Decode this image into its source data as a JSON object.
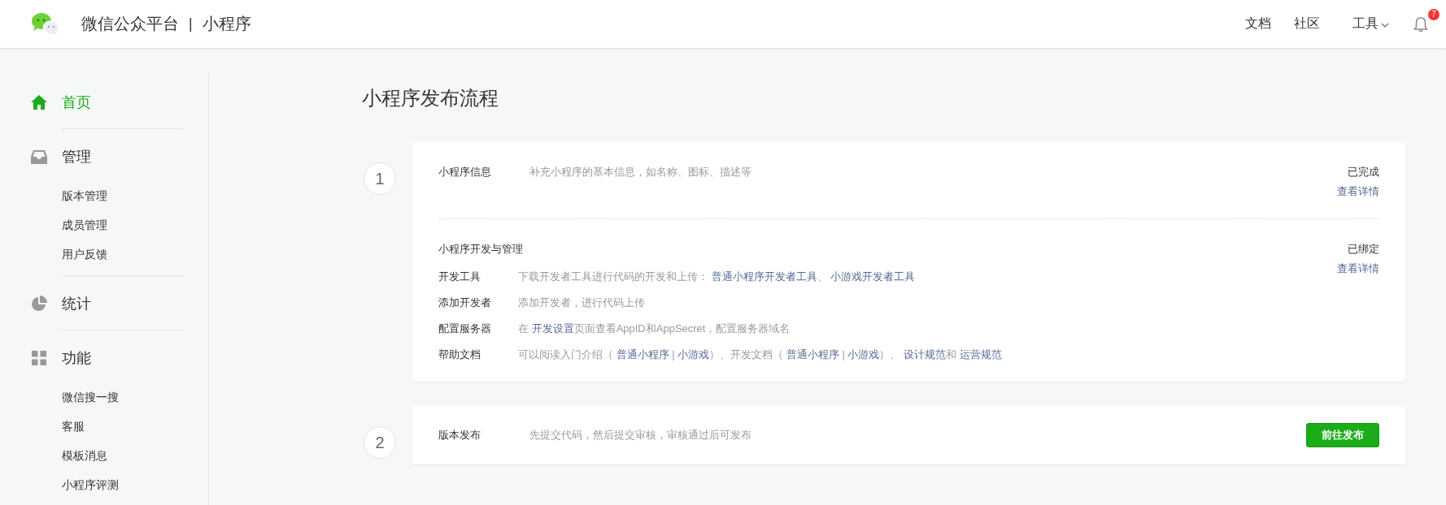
{
  "header": {
    "brand": "微信公众平台",
    "separator": "|",
    "product": "小程序",
    "nav": [
      {
        "label": "文档",
        "kind": "link"
      },
      {
        "label": "社区",
        "kind": "link"
      },
      {
        "label": "工具",
        "kind": "dropdown"
      }
    ],
    "notification_count": "7"
  },
  "sidebar": {
    "groups": [
      {
        "label": "首页",
        "selected": true
      },
      {
        "label": "管理",
        "selected": false,
        "children": [
          {
            "label": "版本管理",
            "selected": false
          },
          {
            "label": "成员管理",
            "selected": false
          },
          {
            "label": "用户反馈",
            "selected": false
          }
        ]
      },
      {
        "label": "统计",
        "selected": false
      },
      {
        "label": "功能",
        "selected": false,
        "children": [
          {
            "label": "微信搜一搜",
            "selected": false
          },
          {
            "label": "客服",
            "selected": false
          },
          {
            "label": "模板消息",
            "selected": false
          },
          {
            "label": "小程序评测",
            "selected": false
          }
        ]
      }
    ]
  },
  "page_title": "小程序发布流程",
  "steps": [
    {
      "number": "1",
      "sections": [
        {
          "title": "小程序信息",
          "description": [
            {
              "kind": "text",
              "text": "补充小程序的基本信息，如名称、图标、描述等"
            }
          ],
          "status": "已完成",
          "detail_link": "查看详情"
        },
        {
          "title": "小程序开发与管理",
          "status": "已绑定",
          "detail_link": "查看详情",
          "rows": [
            {
              "label": "开发工具",
              "description": [
                {
                  "kind": "text",
                  "text": "下载开发者工具进行代码的开发和上传： "
                },
                {
                  "kind": "link",
                  "text": "普通小程序开发者工具"
                },
                {
                  "kind": "text",
                  "text": "、 "
                },
                {
                  "kind": "link",
                  "text": "小游戏开发者工具"
                }
              ]
            },
            {
              "label": "添加开发者",
              "description": [
                {
                  "kind": "text",
                  "text": "添加开发者，进行代码上传"
                }
              ]
            },
            {
              "label": "配置服务器",
              "description": [
                {
                  "kind": "text",
                  "text": "在 "
                },
                {
                  "kind": "link",
                  "text": "开发设置"
                },
                {
                  "kind": "text",
                  "text": "页面查看AppID和AppSecret，配置服务器域名"
                }
              ]
            },
            {
              "label": "帮助文档",
              "description": [
                {
                  "kind": "text",
                  "text": "可以阅读入门介绍（ "
                },
                {
                  "kind": "link",
                  "text": "普通小程序"
                },
                {
                  "kind": "text",
                  "text": " | "
                },
                {
                  "kind": "link",
                  "text": "小游戏"
                },
                {
                  "kind": "text",
                  "text": "）、开发文档（ "
                },
                {
                  "kind": "link",
                  "text": "普通小程序"
                },
                {
                  "kind": "text",
                  "text": " | "
                },
                {
                  "kind": "link",
                  "text": "小游戏"
                },
                {
                  "kind": "text",
                  "text": "）、 "
                },
                {
                  "kind": "link",
                  "text": "设计规范"
                },
                {
                  "kind": "text",
                  "text": "和 "
                },
                {
                  "kind": "link",
                  "text": "运营规范"
                }
              ]
            }
          ]
        }
      ]
    },
    {
      "number": "2",
      "sections": [
        {
          "title": "版本发布",
          "description": [
            {
              "kind": "text",
              "text": "先提交代码，然后提交审核，审核通过后可发布"
            }
          ],
          "action": "前往发布"
        }
      ]
    }
  ]
}
